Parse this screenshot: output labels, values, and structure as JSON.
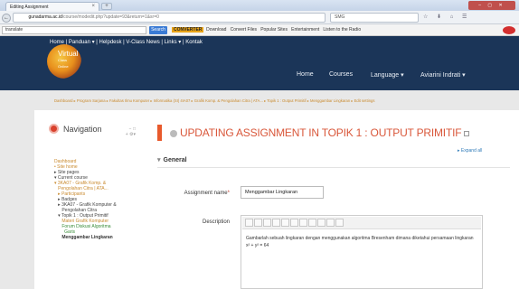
{
  "browser": {
    "tab_title": "Editing Assignment",
    "tab_close": "×",
    "new_tab": "+",
    "url_prefix": "         ",
    "url_domain": "gunadarma.ac.id",
    "url_rest": "/course/modedit.php?update=93&return=1&sr=0",
    "search_text": "SMG",
    "nav_symbols": "☆ ⬇ ⌂ ☰",
    "win_symbols": "– ▢ ✕",
    "search_toolbar_text": "translate",
    "search_button": "Search",
    "toolbar_links": "  Download   Convert Files   Popular Sites   Entertainment   Listen to the Radio",
    "toolbar_brand": "CONVERTER"
  },
  "site": {
    "menubar_links": "Home | Panduan ▾ | Helpdesk | V-Class News | Links ▾ | Kontak",
    "logo_main": "Virtual",
    "logo_sub1": "Class",
    "logo_sub2": "Online",
    "nav_home": "Home",
    "nav_courses": "Courses",
    "nav_language": "Language ▾",
    "nav_user": "Aviarini Indrati ▾"
  },
  "breadcrumb": "Dashboard ▸ Program Sarjana ▸ Fakultas Ilmu Komputer ▸ Informatika (SI) 4IA07 ▸ Grafik Komp. & Pengolahan Citra | ATA... ▸ Topik 1 : Output Primitif ▸ Menggambar Lingkaran ▸ Edit settings",
  "nav": {
    "title": "Navigation",
    "controls": "− □\n+ ⚙▾",
    "items": [
      {
        "label": "Dashboard"
      },
      {
        "label": "• Site home"
      },
      {
        "label": "▸ Site pages"
      },
      {
        "label": "▾ Current course"
      },
      {
        "label": "▾ 3KA07 - Grafik Komp. &"
      },
      {
        "label": "   Pengolahan Citra | ATA..."
      },
      {
        "label": "   ▸ Participants"
      },
      {
        "label": "   ▸ Badges"
      },
      {
        "label": "   ▸ 3KA07 - Grafik Komputer &"
      },
      {
        "label": "      Pengolahan Citra"
      },
      {
        "label": "   ▾ Topik 1 : Output Primitif"
      },
      {
        "label": "      Materi Grafik Komputer"
      },
      {
        "label": "      Forum Diskusi Algoritma"
      },
      {
        "label": "        Garis"
      },
      {
        "label": "      Menggambar Lingkaran"
      }
    ]
  },
  "main": {
    "title": "UPDATING ASSIGNMENT IN TOPIK 1 : OUTPUT PRIMITIF",
    "expand_all": "▸ Expand all",
    "section": "General",
    "section_arrow": "▾",
    "name_label": "Assignment name",
    "required_mark": "*",
    "name_value": "Menggambar Lingkaran",
    "desc_label": "Description",
    "desc_text": "Gambarlah sebuah lingkaran dengan menggunakan algoritma Bresenham dimana diketahui persamaan lingkaran x² + y² = 64"
  }
}
